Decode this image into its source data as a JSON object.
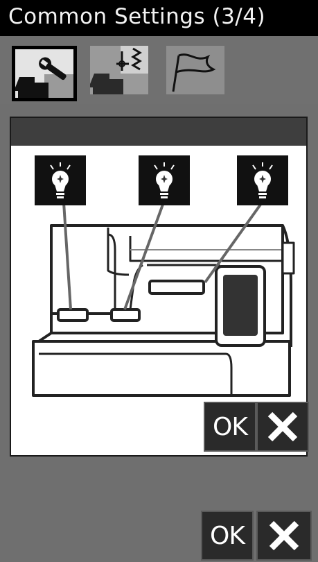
{
  "window": {
    "title": "Common Settings (3/4)"
  },
  "tabs": [
    {
      "name": "machine-settings",
      "icon": "wrench-machine-icon",
      "active": true
    },
    {
      "name": "sewing-settings",
      "icon": "needle-stitch-icon",
      "active": false
    },
    {
      "name": "language-settings",
      "icon": "flag-icon",
      "active": false
    }
  ],
  "dialog": {
    "lamps": [
      {
        "icon": "light-bulb-icon",
        "position": "left"
      },
      {
        "icon": "light-bulb-icon",
        "position": "center"
      },
      {
        "icon": "light-bulb-icon",
        "position": "right"
      }
    ],
    "ok_label": "OK",
    "cancel_icon": "close-icon"
  },
  "footer": {
    "ok_label": "OK",
    "cancel_icon": "close-icon"
  },
  "colors": {
    "background": "#6f6f6f",
    "titlebar": "#000000",
    "button": "#2a2a2a",
    "panel": "#ffffff"
  }
}
